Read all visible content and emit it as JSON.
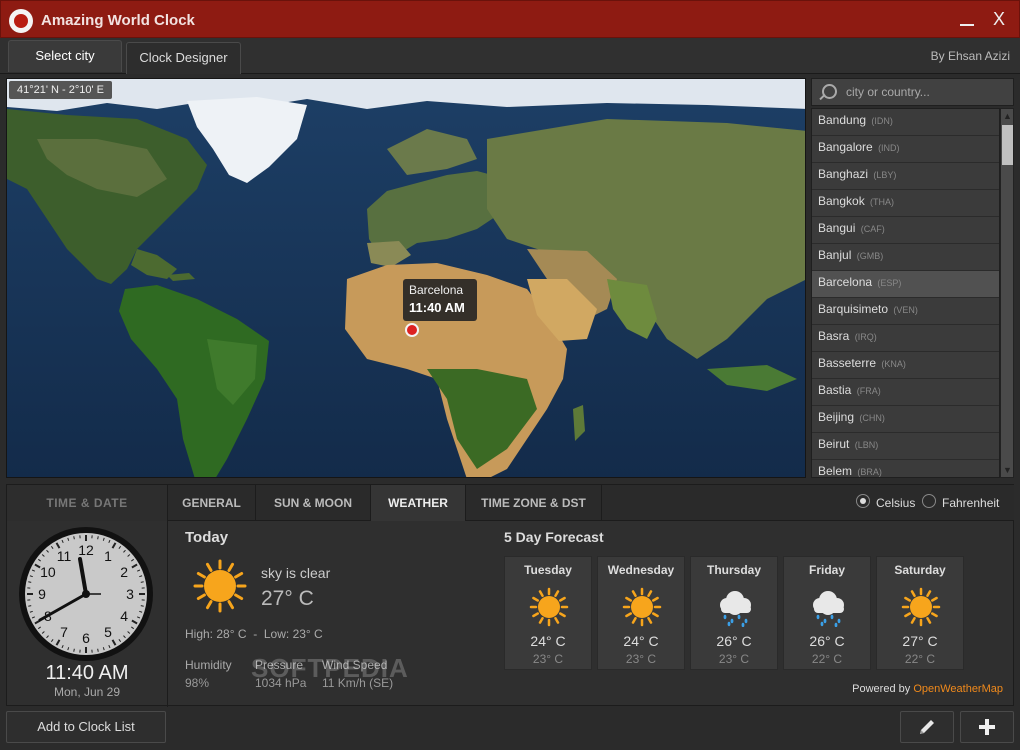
{
  "app": {
    "title": "Amazing World Clock",
    "minimize_icon": "minimize-icon",
    "close_glyph": "X"
  },
  "tabs": [
    {
      "label": "Select city"
    },
    {
      "label": "Clock Designer"
    }
  ],
  "author": "By Ehsan Azizi",
  "map": {
    "coords": "41°21' N  -  2°10' E",
    "tooltip": {
      "city": "Barcelona",
      "time": "11:40 AM"
    }
  },
  "search": {
    "placeholder": "city or country..."
  },
  "cities": [
    {
      "name": "Bandung",
      "code": "(IDN)"
    },
    {
      "name": "Bangalore",
      "code": "(IND)"
    },
    {
      "name": "Banghazi",
      "code": "(LBY)"
    },
    {
      "name": "Bangkok",
      "code": "(THA)"
    },
    {
      "name": "Bangui",
      "code": "(CAF)"
    },
    {
      "name": "Banjul",
      "code": "(GMB)"
    },
    {
      "name": "Barcelona",
      "code": "(ESP)"
    },
    {
      "name": "Barquisimeto",
      "code": "(VEN)"
    },
    {
      "name": "Basra",
      "code": "(IRQ)"
    },
    {
      "name": "Basseterre",
      "code": "(KNA)"
    },
    {
      "name": "Bastia",
      "code": "(FRA)"
    },
    {
      "name": "Beijing",
      "code": "(CHN)"
    },
    {
      "name": "Beirut",
      "code": "(LBN)"
    },
    {
      "name": "Belem",
      "code": "(BRA)"
    }
  ],
  "selected_city": "Barcelona",
  "time_date": {
    "header": "TIME & DATE",
    "time": "11:40 AM",
    "date": "Mon, Jun 29",
    "clock_numbers": [
      "12",
      "1",
      "2",
      "3",
      "4",
      "5",
      "6",
      "7",
      "8",
      "9",
      "10",
      "11"
    ]
  },
  "sub_tabs": [
    {
      "label": "GENERAL"
    },
    {
      "label": "SUN & MOON"
    },
    {
      "label": "WEATHER"
    },
    {
      "label": "TIME ZONE & DST"
    }
  ],
  "units": {
    "celsius": "Celsius",
    "fahrenheit": "Fahrenheit",
    "selected": "Celsius"
  },
  "weather": {
    "today": {
      "title": "Today",
      "condition": "sky is clear",
      "temp": "27° C",
      "high_label": "High:",
      "high": "28° C",
      "low_label": "Low:",
      "low": "23° C",
      "humidity_label": "Humidity",
      "humidity": "98%",
      "pressure_label": "Pressure",
      "pressure": "1034 hPa",
      "wind_label": "Wind Speed",
      "wind": "11 Km/h (SE)"
    },
    "forecast_title": "5 Day Forecast",
    "forecast": [
      {
        "day": "Tuesday",
        "icon": "sun-icon",
        "hi": "24° C",
        "lo": "23° C"
      },
      {
        "day": "Wednesday",
        "icon": "sun-icon",
        "hi": "24° C",
        "lo": "23° C"
      },
      {
        "day": "Thursday",
        "icon": "rain-cloud-icon",
        "hi": "26° C",
        "lo": "23° C"
      },
      {
        "day": "Friday",
        "icon": "rain-cloud-icon",
        "hi": "26° C",
        "lo": "22° C"
      },
      {
        "day": "Saturday",
        "icon": "sun-icon",
        "hi": "27° C",
        "lo": "22° C"
      }
    ],
    "powered_by": "Powered by",
    "provider": "OpenWeatherMap"
  },
  "watermark": "SOFTPEDIA",
  "buttons": {
    "add_to_list": "Add to Clock List",
    "edit_icon": "pencil-icon",
    "add_icon": "plus-icon"
  },
  "colors": {
    "titlebar": "#8e1b12",
    "accent_link": "#f08a1c",
    "sun": "#f7a51c",
    "marker": "#dd2222"
  }
}
